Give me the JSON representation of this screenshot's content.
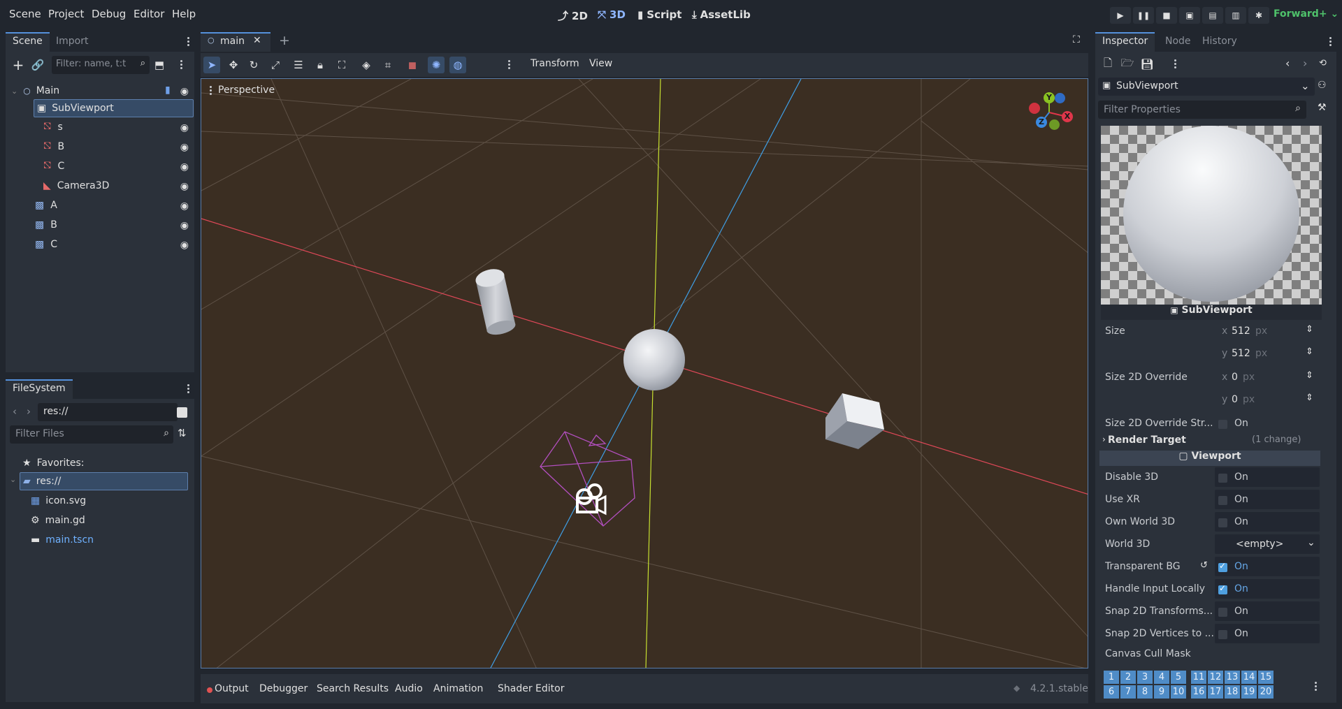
{
  "menu": [
    "Scene",
    "Project",
    "Debug",
    "Editor",
    "Help"
  ],
  "workspaces": [
    {
      "label": "2D",
      "icon": "2d-icon",
      "active": false
    },
    {
      "label": "3D",
      "icon": "3d-icon",
      "active": true
    },
    {
      "label": "Script",
      "icon": "script-icon",
      "active": false
    },
    {
      "label": "AssetLib",
      "icon": "assetlib-icon",
      "active": false
    }
  ],
  "renderer": "Forward+",
  "scene_dock": {
    "tabs": [
      "Scene",
      "Import"
    ],
    "filter_placeholder": "Filter: name, t:t",
    "tree": [
      {
        "label": "Main",
        "icon": "node3d-icon",
        "indent": 0
      },
      {
        "label": "SubViewport",
        "icon": "subviewport-icon",
        "indent": 1,
        "selected": true
      },
      {
        "label": "s",
        "icon": "mesh-icon",
        "indent": 2
      },
      {
        "label": "B",
        "icon": "mesh-icon",
        "indent": 2
      },
      {
        "label": "C",
        "icon": "mesh-icon",
        "indent": 2
      },
      {
        "label": "Camera3D",
        "icon": "camera-icon",
        "indent": 2
      },
      {
        "label": "A",
        "icon": "texturerect-icon",
        "indent": 1
      },
      {
        "label": "B",
        "icon": "texturerect-icon",
        "indent": 1
      },
      {
        "label": "C",
        "icon": "texturerect-icon",
        "indent": 1
      }
    ]
  },
  "filesystem": {
    "tab": "FileSystem",
    "path": "res://",
    "filter_placeholder": "Filter Files",
    "favorites": "Favorites:",
    "items": [
      {
        "label": "res://",
        "icon": "folder-icon",
        "selected": true
      },
      {
        "label": "icon.svg",
        "icon": "image-icon"
      },
      {
        "label": "main.gd",
        "icon": "gear-icon"
      },
      {
        "label": "main.tscn",
        "icon": "scene-icon",
        "link": true
      }
    ]
  },
  "editor": {
    "tab": "main",
    "toolbar_menus": [
      "Transform",
      "View"
    ],
    "perspective": "Perspective"
  },
  "bottom_tabs": [
    "Output",
    "Debugger",
    "Search Results",
    "Audio",
    "Animation",
    "Shader Editor"
  ],
  "version": "4.2.1.stable",
  "inspector": {
    "tabs": [
      "Inspector",
      "Node",
      "History"
    ],
    "object": "SubViewport",
    "filter_placeholder": "Filter Properties",
    "preview_caption": "SubViewport",
    "size_label": "Size",
    "size_x": "512",
    "size_y": "512",
    "size2d_label": "Size 2D Override",
    "size2d_x": "0",
    "size2d_y": "0",
    "unit": "px",
    "x_label": "x",
    "y_label": "y",
    "size2d_stretch_label": "Size 2D Override Str...",
    "render_target": "Render Target",
    "render_target_changes": "(1 change)",
    "viewport_section": "Viewport",
    "props": [
      {
        "label": "Disable 3D",
        "value": "On",
        "checked": false
      },
      {
        "label": "Use XR",
        "value": "On",
        "checked": false
      },
      {
        "label": "Own World 3D",
        "value": "On",
        "checked": false
      }
    ],
    "world3d_label": "World 3D",
    "world3d_value": "<empty>",
    "props2": [
      {
        "label": "Transparent BG",
        "value": "On",
        "checked": true
      },
      {
        "label": "Handle Input Locally",
        "value": "On",
        "checked": true
      },
      {
        "label": "Snap 2D Transforms...",
        "value": "On",
        "checked": false
      },
      {
        "label": "Snap 2D Vertices to ...",
        "value": "On",
        "checked": false
      }
    ],
    "canvas_cull_label": "Canvas Cull Mask",
    "cull_row1": [
      "1",
      "2",
      "3",
      "4",
      "5",
      "11",
      "12",
      "13",
      "14",
      "15"
    ],
    "cull_row2": [
      "6",
      "7",
      "8",
      "9",
      "10",
      "16",
      "17",
      "18",
      "19",
      "20"
    ],
    "on_label": "On"
  },
  "gizmo": {
    "y": "Y",
    "x": "X",
    "z": "Z"
  }
}
